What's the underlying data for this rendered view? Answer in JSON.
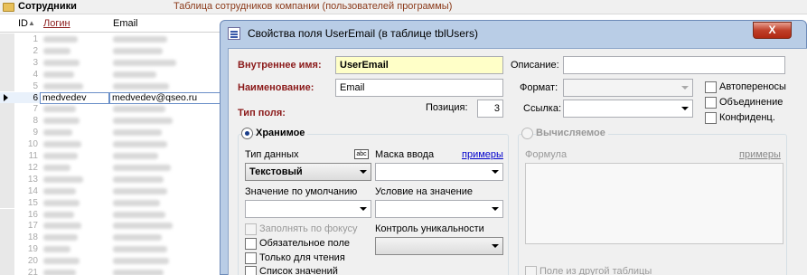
{
  "bg": {
    "title": "Сотрудники",
    "subtitle": "Таблица сотрудников компании (пользователей программы)",
    "columns": {
      "id": "ID",
      "login": "Логин",
      "email": "Email"
    },
    "row_ids": [
      "1",
      "2",
      "3",
      "4",
      "5",
      "6",
      "7",
      "8",
      "9",
      "10",
      "11",
      "12",
      "13",
      "14",
      "15",
      "16",
      "17",
      "18",
      "19",
      "20",
      "21"
    ],
    "current_row": {
      "id": "6",
      "login": "medvedev",
      "email": "medvedev@qseo.ru"
    }
  },
  "dialog": {
    "title": "Свойства поля UserEmail (в таблице tblUsers)",
    "close_label": "X",
    "internal_name_label": "Внутреннее имя:",
    "internal_name_value": "UserEmail",
    "name_label": "Наименование:",
    "name_value": "Email",
    "field_type_label": "Тип поля:",
    "position_label": "Позиция:",
    "position_value": "3",
    "description_label": "Описание:",
    "description_value": "",
    "format_label": "Формат:",
    "format_value": "",
    "link_label": "Ссылка:",
    "link_value": "",
    "checks_right": [
      "Автопереносы",
      "Объединение",
      "Конфиденц."
    ],
    "stored": {
      "label": "Хранимое",
      "data_type_label": "Тип данных",
      "data_type_value": "Текстовый",
      "abc_icon": "abc",
      "mask_label": "Маска ввода",
      "mask_link": "примеры",
      "default_label": "Значение по умолчанию",
      "condition_label": "Условие на значение",
      "fill_focus": "Заполнять по фокусу",
      "required": "Обязательное поле",
      "readonly": "Только для чтения",
      "value_list": "Список значений",
      "uniqueness_label": "Контроль уникальности"
    },
    "computed": {
      "label": "Вычисляемое",
      "formula_label": "Формула",
      "formula_link": "примеры",
      "other_table": "Поле из другой таблицы"
    }
  }
}
